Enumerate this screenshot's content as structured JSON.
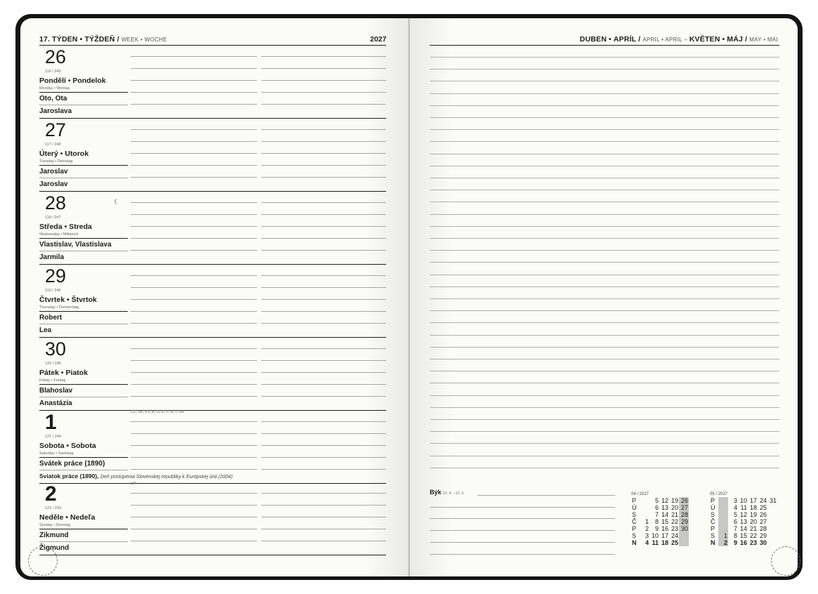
{
  "left_header": {
    "week_num": "17.",
    "week_cz": "TÝDEN",
    "sep1": "•",
    "week_sk": "TÝŽDEŇ /",
    "week_en_de": "WEEK • WOCHE",
    "year": "2027"
  },
  "right_header": {
    "month1_cz": "DUBEN",
    "sep": "•",
    "month1_sk": "APRÍL /",
    "month1_en_de": "APRIL • APRIL –",
    "month2_cz": "KVĚTEN",
    "sep2": "•",
    "month2_sk": "MÁJ /",
    "month2_en_de": "MAY • MAI"
  },
  "days": [
    {
      "num": "26",
      "count": "116 / 249",
      "name": "Pondělí • Pondelok",
      "sub": "Monday • Montag",
      "name_cz": "Oto, Ota",
      "name_sk": "Jaroslava"
    },
    {
      "num": "27",
      "count": "117 / 248",
      "name": "Úterý • Utorok",
      "sub": "Tuesday • Dienstag",
      "name_cz": "Jaroslav",
      "name_sk": "Jaroslav"
    },
    {
      "num": "28",
      "count": "118 / 247",
      "name": "Středa • Streda",
      "sub": "Wednesday • Mittwoch",
      "name_cz": "Vlastislav, Vlastislava",
      "name_sk": "Jarmila",
      "moon": "☾"
    },
    {
      "num": "29",
      "count": "119 / 246",
      "name": "Čtvrtek • Štvrtok",
      "sub": "Thursday • Donnerstag",
      "name_cz": "Robert",
      "name_sk": "Lea"
    },
    {
      "num": "30",
      "count": "120 / 245",
      "name": "Pátek • Piatok",
      "sub": "Friday • Freitag",
      "name_cz": "Blahoslav",
      "name_sk": "Anastázia"
    },
    {
      "num": "1",
      "count": "121 / 244",
      "name": "Sobota • Sobota",
      "sub": "Saturday • Samstag",
      "name_cz": "Svátek práce (1890)",
      "name_sk": "Sviatok práce (1890),",
      "name_sk_extra": "Deň pristúpenia Slovenskej republiky k Európskej únii (2004)",
      "holiday": "CZ, SK, PL, A, D, E, F, H, I, UA"
    },
    {
      "num": "2",
      "count": "122 / 243",
      "name": "Neděle • Nedeľa",
      "sub": "Sunday • Sonntag",
      "name_cz": "Zikmund",
      "name_sk": "Žigmund",
      "holiday": "UA"
    }
  ],
  "zodiac": {
    "sign": "Býk",
    "range": "21. 4. – 21. 5."
  },
  "mini_cal_april": {
    "caption": "04 / 2027",
    "rows": [
      {
        "d": "P",
        "v": [
          "",
          "5",
          "12",
          "19",
          "26"
        ]
      },
      {
        "d": "Ú",
        "v": [
          "",
          "6",
          "13",
          "20",
          "27"
        ]
      },
      {
        "d": "S",
        "v": [
          "",
          "7",
          "14",
          "21",
          "28"
        ]
      },
      {
        "d": "Č",
        "v": [
          "1",
          "8",
          "15",
          "22",
          "29"
        ]
      },
      {
        "d": "P",
        "v": [
          "2",
          "9",
          "16",
          "23",
          "30"
        ]
      },
      {
        "d": "S",
        "v": [
          "3",
          "10",
          "17",
          "24",
          ""
        ]
      },
      {
        "d": "N",
        "v": [
          "4",
          "11",
          "18",
          "25",
          ""
        ]
      }
    ]
  },
  "mini_cal_may": {
    "caption": "05 / 2027",
    "rows": [
      {
        "d": "P",
        "v": [
          "",
          "3",
          "10",
          "17",
          "24",
          "31"
        ]
      },
      {
        "d": "Ú",
        "v": [
          "",
          "4",
          "11",
          "18",
          "25",
          ""
        ]
      },
      {
        "d": "S",
        "v": [
          "",
          "5",
          "12",
          "19",
          "26",
          ""
        ]
      },
      {
        "d": "Č",
        "v": [
          "",
          "6",
          "13",
          "20",
          "27",
          ""
        ]
      },
      {
        "d": "P",
        "v": [
          "",
          "7",
          "14",
          "21",
          "28",
          ""
        ]
      },
      {
        "d": "S",
        "v": [
          "1",
          "8",
          "15",
          "22",
          "29",
          ""
        ]
      },
      {
        "d": "N",
        "v": [
          "2",
          "9",
          "16",
          "23",
          "30",
          ""
        ]
      }
    ]
  }
}
